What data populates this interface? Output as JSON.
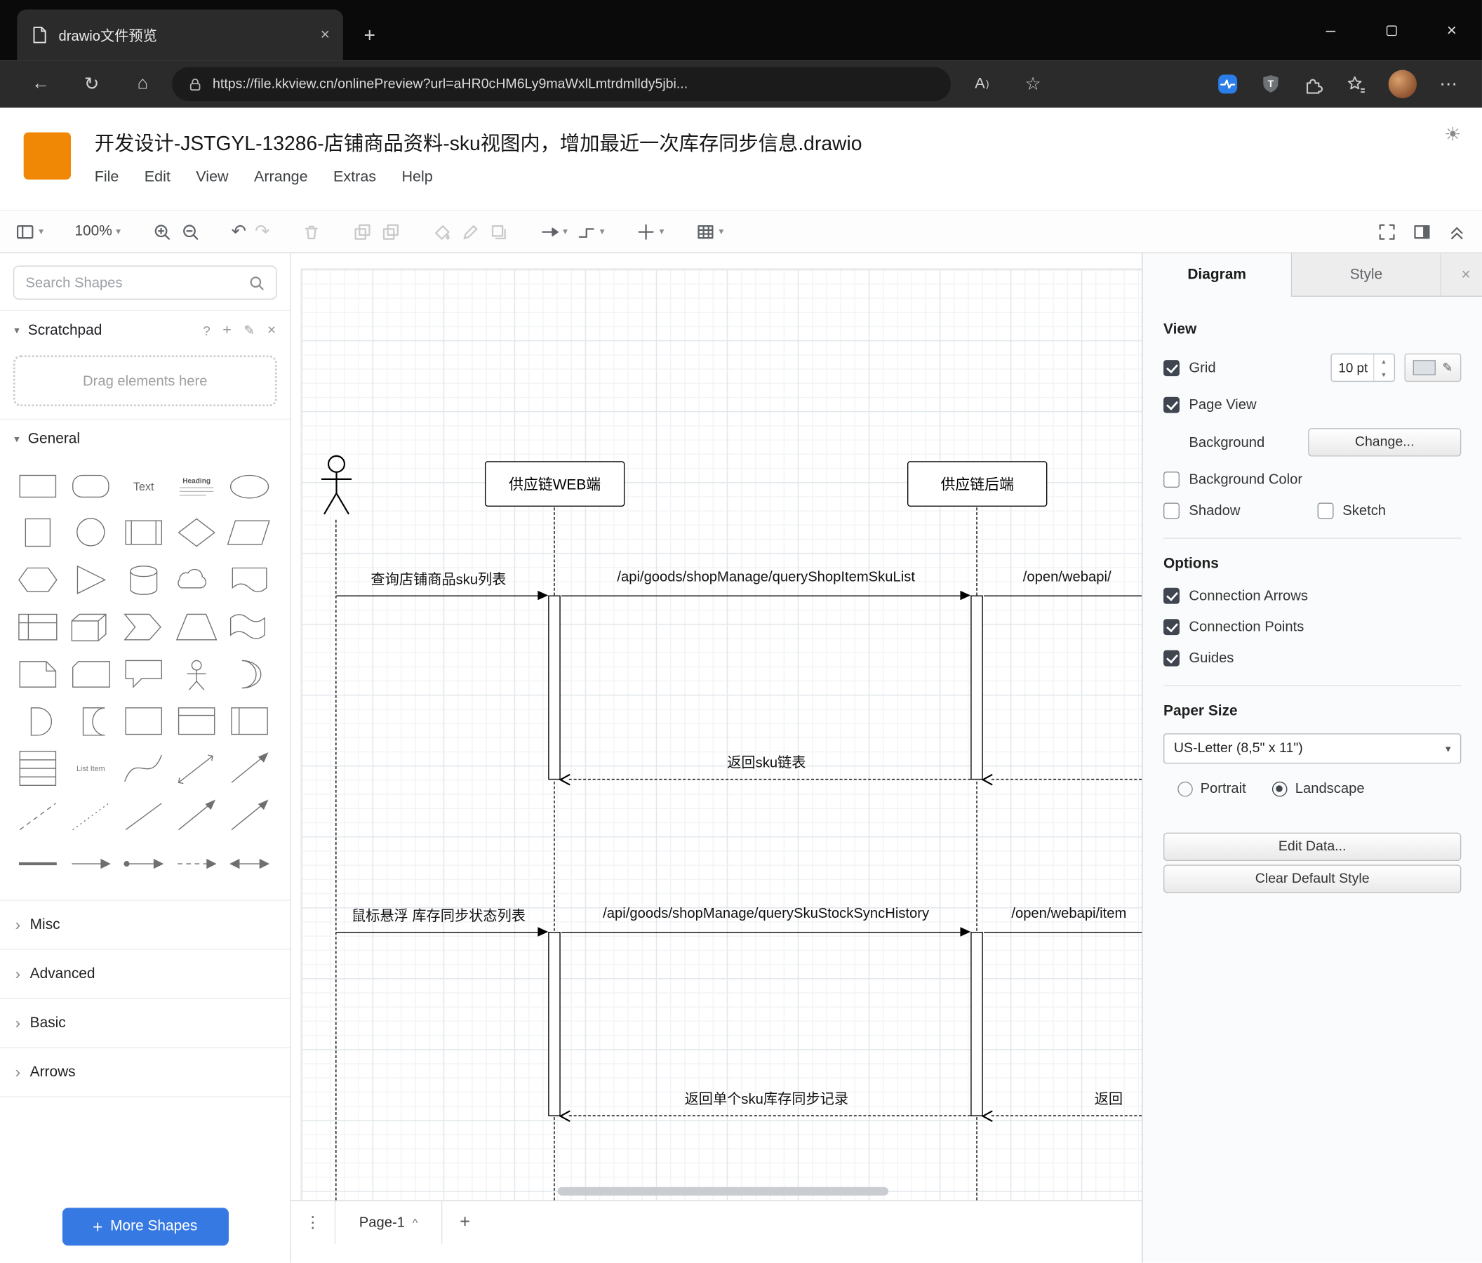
{
  "glyphs": {
    "minimize": "–",
    "close": "×",
    "tab_close": "×",
    "new_tab": "+",
    "back": "←",
    "refresh": "↻",
    "home": "⌂",
    "read_aloud": "A",
    "read_aloud_paren": ")",
    "favorite_star": "☆",
    "more": "⋯",
    "kebab": "⋮",
    "undo": "↶",
    "redo": "↷",
    "caret": "▾",
    "chevron_down": "▾",
    "chevron_right": "›",
    "chevron_up": "^",
    "sun": "☀",
    "question": "?",
    "plus": "+",
    "pencil": "✎",
    "spin_up": "▴",
    "spin_down": "▾"
  },
  "browser": {
    "tab_title": "drawio文件预览",
    "url": "https://file.kkview.cn/onlinePreview?url=aHR0cHM6Ly9maWxlLmtrdmlldy5jbi..."
  },
  "header": {
    "title": "开发设计-JSTGYL-13286-店铺商品资料-sku视图内，增加最近一次库存同步信息.drawio",
    "menus": [
      "File",
      "Edit",
      "View",
      "Arrange",
      "Extras",
      "Help"
    ]
  },
  "toolbar": {
    "zoom": "100%"
  },
  "sidebar": {
    "search_placeholder": "Search Shapes",
    "scratchpad_label": "Scratchpad",
    "scratchpad_hint": "Drag elements here",
    "general_label": "General",
    "sections": [
      "Misc",
      "Advanced",
      "Basic",
      "Arrows"
    ],
    "more_shapes_label": "More Shapes",
    "palette_labels": {
      "text": "Text",
      "heading": "Heading",
      "list_item": "List Item"
    }
  },
  "diagram": {
    "actors": [
      "供应链WEB端",
      "供应链后端"
    ],
    "messages": {
      "m1": "查询店铺商品sku列表",
      "m2": "/api/goods/shopManage/queryShopItemSkuList",
      "m3": "/open/webapi/",
      "r1": "返回sku链表",
      "m4": "鼠标悬浮 库存同步状态列表",
      "m5": "/api/goods/shopManage/querySkuStockSyncHistory",
      "m6": "/open/webapi/item",
      "r2": "返回单个sku库存同步记录",
      "r3": "返回"
    }
  },
  "footer": {
    "page_tab": "Page-1"
  },
  "panel": {
    "tabs": [
      "Diagram",
      "Style"
    ],
    "view_heading": "View",
    "grid_label": "Grid",
    "grid_size": "10 pt",
    "page_view_label": "Page View",
    "background_label": "Background",
    "change_button": "Change...",
    "background_color_label": "Background Color",
    "shadow_label": "Shadow",
    "sketch_label": "Sketch",
    "options_heading": "Options",
    "options": [
      "Connection Arrows",
      "Connection Points",
      "Guides"
    ],
    "paper_heading": "Paper Size",
    "paper_size": "US-Letter (8,5\" x 11\")",
    "portrait_label": "Portrait",
    "landscape_label": "Landscape",
    "edit_data_button": "Edit Data...",
    "clear_style_button": "Clear Default Style"
  }
}
